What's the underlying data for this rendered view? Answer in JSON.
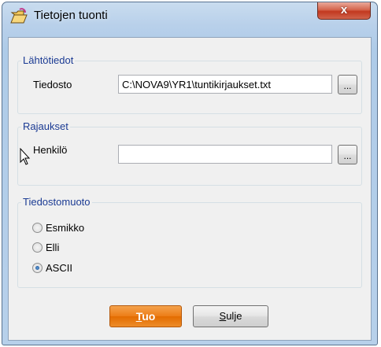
{
  "window": {
    "title": "Tietojen tuonti",
    "close_label": "x"
  },
  "source_group": {
    "legend": "Lähtötiedot",
    "file_label": "Tiedosto",
    "file_value": "C:\\NOVA9\\YR1\\tuntikirjaukset.txt",
    "browse_label": "..."
  },
  "limits_group": {
    "legend": "Rajaukset",
    "person_label": "Henkilö",
    "person_value": "",
    "browse_label": "..."
  },
  "format_group": {
    "legend": "Tiedostomuoto",
    "options": [
      {
        "label": "Esmikko",
        "selected": false
      },
      {
        "label": "Elli",
        "selected": false
      },
      {
        "label": "ASCII",
        "selected": true
      }
    ]
  },
  "buttons": {
    "import_mnemonic": "T",
    "import_rest": "uo",
    "close_mnemonic": "S",
    "close_rest": "ulje"
  },
  "colors": {
    "legend_text": "#1a3a93",
    "primary_button": "#ec7d17",
    "close_button": "#c2381f"
  }
}
